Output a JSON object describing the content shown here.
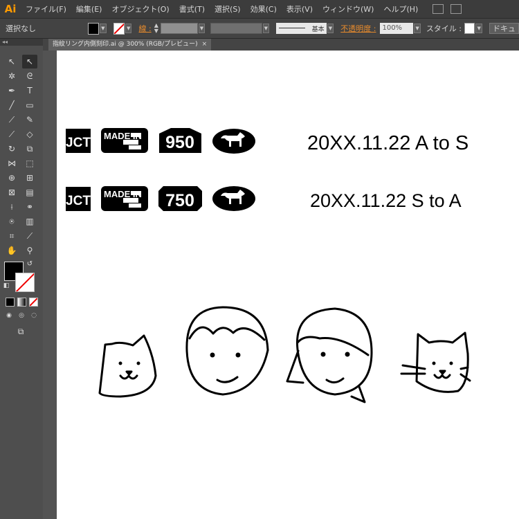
{
  "app": {
    "logo": "Ai"
  },
  "menubar": {
    "items": [
      "ファイル(F)",
      "編集(E)",
      "オブジェクト(O)",
      "書式(T)",
      "選択(S)",
      "効果(C)",
      "表示(V)",
      "ウィンドウ(W)",
      "ヘルプ(H)"
    ],
    "icons": [
      "bridge-icon",
      "arrange-documents-icon"
    ]
  },
  "controlbar": {
    "selection": "選択なし",
    "stroke_label": "線 :",
    "stroke_profile": "基本",
    "opacity_label": "不透明度 :",
    "opacity_value": "100%",
    "style_label": "スタイル :",
    "doc_button": "ドキュ"
  },
  "document": {
    "tab_title": "指紋リング内側刻印.ai @ 300% (RGB/プレビュー)",
    "close": "×"
  },
  "artwork": {
    "row1": {
      "badges": [
        "JCT",
        "MADE IN",
        "950"
      ],
      "date_text": "20XX.11.22 A to S"
    },
    "row2": {
      "badges": [
        "JCT",
        "MADE IN",
        "750"
      ],
      "date_text": "20XX.11.22 S to A"
    },
    "faces": [
      "dog-face-icon",
      "boy-face-icon",
      "girl-face-icon",
      "cat-face-icon"
    ]
  },
  "colors": {
    "accent": "#ff9a00",
    "label_orange": "#e88b2c",
    "ui_dark": "#535353"
  }
}
